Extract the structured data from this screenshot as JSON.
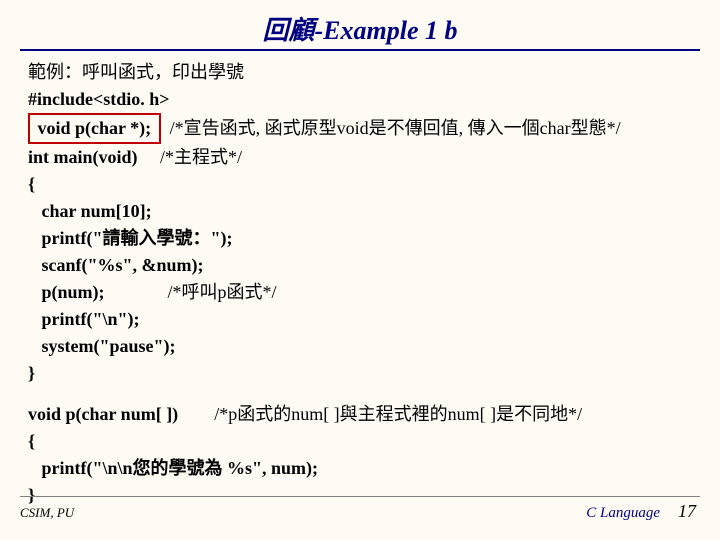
{
  "title": "回顧-Example 1 b",
  "lines": {
    "l0": "範例：呼叫函式，印出學號",
    "l1": "#include<stdio. h>",
    "boxed": " void p(char *); ",
    "c1": "  /*宣告函式, 函式原型void是不傳回值, 傳入一個char型態*/",
    "l3a": "int main(void)",
    "l3b": "     /*主程式*/",
    "l4": "{",
    "l5": "   char num[10];",
    "l6": "   printf(\"請輸入學號：\");",
    "l7": "   scanf(\"%s\", &num);",
    "l8a": "   p(num);",
    "l8b": "              /*呼叫p函式*/",
    "l9": "   printf(\"\\n\");",
    "l10": "   system(\"pause\");",
    "l11": "}",
    "l12a": "void p(char num[ ])",
    "l12b": "        /*p函式的num[ ]與主程式裡的num[ ]是不同地*/",
    "l13": "{",
    "l14": "   printf(\"\\n\\n您的學號為 %s\", num);",
    "l15": "}"
  },
  "footer": {
    "left": "CSIM, PU",
    "right": "C Language",
    "page": "17"
  }
}
